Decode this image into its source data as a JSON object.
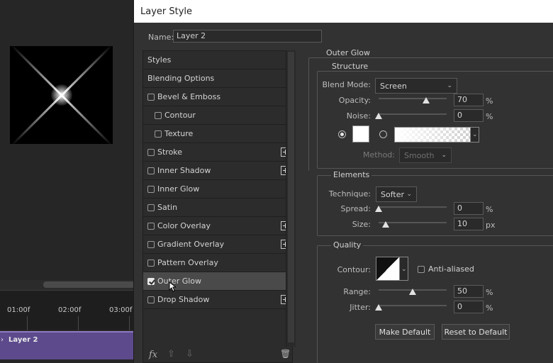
{
  "timeline": {
    "ticks": [
      "01:00f",
      "02:00f",
      "03:00f"
    ],
    "layer_name": "Layer 2",
    "chevron": "›"
  },
  "dialog": {
    "title": "Layer Style",
    "name_label": "Name:",
    "name_value": "Layer 2"
  },
  "styles": {
    "items": [
      {
        "label": "Styles"
      },
      {
        "label": "Blending Options"
      },
      {
        "label": "Bevel & Emboss",
        "checked": false
      },
      {
        "label": "Contour",
        "checked": false
      },
      {
        "label": "Texture",
        "checked": false
      },
      {
        "label": "Stroke",
        "checked": false,
        "plus": true
      },
      {
        "label": "Inner Shadow",
        "checked": false,
        "plus": true
      },
      {
        "label": "Inner Glow",
        "checked": false
      },
      {
        "label": "Satin",
        "checked": false
      },
      {
        "label": "Color Overlay",
        "checked": false,
        "plus": true
      },
      {
        "label": "Gradient Overlay",
        "checked": false,
        "plus": true
      },
      {
        "label": "Pattern Overlay",
        "checked": false
      },
      {
        "label": "Outer Glow",
        "checked": true,
        "selected": true
      },
      {
        "label": "Drop Shadow",
        "checked": false,
        "plus": true
      }
    ],
    "toolbar": {
      "fx": "fx",
      "up": "⇧",
      "down": "⇩",
      "trash": "🗑"
    }
  },
  "outer_glow": {
    "title": "Outer Glow",
    "structure": {
      "legend": "Structure",
      "blend_mode_label": "Blend Mode:",
      "blend_mode": "Screen",
      "opacity_label": "Opacity:",
      "opacity": "70",
      "opacity_value": 70,
      "noise_label": "Noise:",
      "noise": "0",
      "noise_value": 0,
      "percent": "%",
      "method_label": "Method:",
      "method": "Smooth",
      "glow_color": "#ffffff"
    },
    "elements": {
      "legend": "Elements",
      "technique_label": "Technique:",
      "technique": "Softer",
      "spread_label": "Spread:",
      "spread": "0",
      "spread_value": 0,
      "size_label": "Size:",
      "size": "10",
      "size_value": 10,
      "size_unit": "px",
      "percent": "%"
    },
    "quality": {
      "legend": "Quality",
      "contour_label": "Contour:",
      "anti_aliased_label": "Anti-aliased",
      "anti_aliased": false,
      "range_label": "Range:",
      "range": "50",
      "range_value": 50,
      "jitter_label": "Jitter:",
      "jitter": "0",
      "jitter_value": 0,
      "percent": "%"
    },
    "buttons": {
      "make_default": "Make Default",
      "reset_to_default": "Reset to Default"
    }
  },
  "icons": {
    "caret": "⌄"
  }
}
